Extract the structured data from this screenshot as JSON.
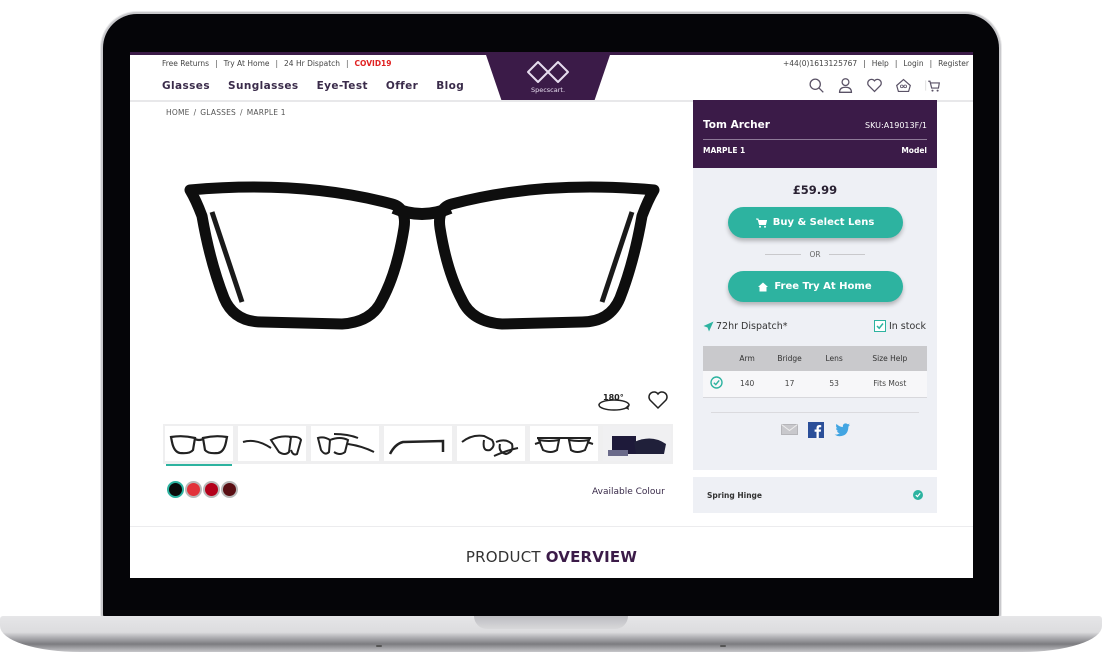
{
  "utility_bar": {
    "left_links": [
      "Free Returns",
      "Try At Home",
      "24 Hr Dispatch"
    ],
    "covid_link": "COVID19",
    "phone": "+44(0)1613125767",
    "right_links": [
      "Help",
      "Login",
      "Register"
    ],
    "separator": "|"
  },
  "nav": {
    "items": [
      "Glasses",
      "Sunglasses",
      "Eye-Test",
      "Offer",
      "Blog"
    ]
  },
  "logo": {
    "text": "Specscart."
  },
  "header_icons": [
    "search-icon",
    "user-icon",
    "heart-icon",
    "try-at-home-icon",
    "cart-icon"
  ],
  "breadcrumb": {
    "items": [
      "HOME",
      "GLASSES",
      "MARPLE 1"
    ],
    "separator": "/"
  },
  "product": {
    "brand": "Tom Archer",
    "sku": "SKU:A19013F/1",
    "model_name": "MARPLE 1",
    "model_label": "Model",
    "price": "£59.99",
    "buy_button": "Buy & Select Lens",
    "or_label": "OR",
    "try_button": "Free Try At Home",
    "dispatch": "72hr Dispatch*",
    "stock": "In stock",
    "stock_checked": true,
    "spin_label": "180°"
  },
  "size_table": {
    "headers": [
      "",
      "Arm",
      "Bridge",
      "Lens",
      "Size Help"
    ],
    "row": [
      "",
      "140",
      "17",
      "53",
      "Fits Most"
    ]
  },
  "share_icons": [
    "email-icon",
    "facebook-icon",
    "twitter-icon"
  ],
  "features": [
    {
      "label": "Spring Hinge",
      "included": true
    }
  ],
  "thumbnails": [
    "front",
    "angled-left",
    "angled-right",
    "side",
    "folded",
    "top",
    "case"
  ],
  "selected_thumbnail": 0,
  "colours": {
    "label": "Available Colour",
    "swatches": [
      "#0a0a0a",
      "#e2323a",
      "#b3001a",
      "#5a0f14"
    ],
    "selected": 0
  },
  "overview": {
    "prefix": "PRODUCT",
    "emphasis": "OVERVIEW"
  },
  "theme": {
    "primary": "#3b1b48",
    "accent": "#2db3a0",
    "covid": "#e02020"
  }
}
